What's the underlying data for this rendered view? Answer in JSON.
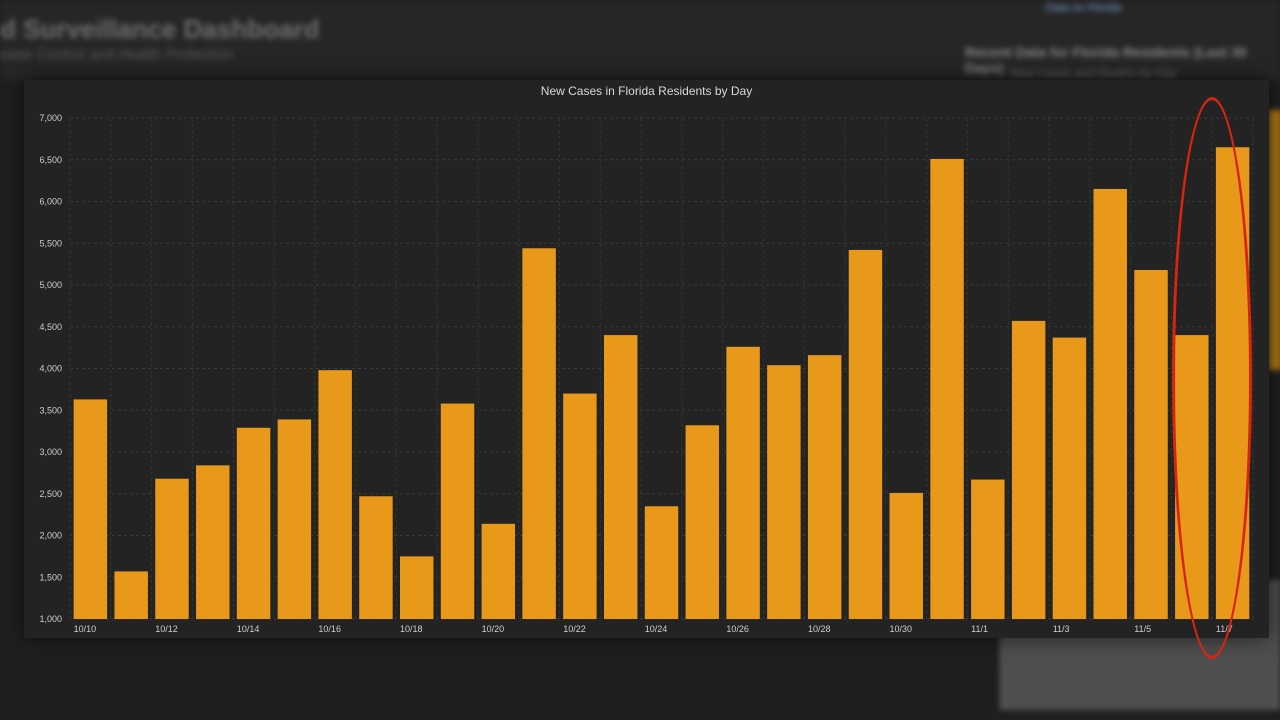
{
  "backdrop": {
    "title": "d Surveillance Dashboard",
    "subtitle": "ease Control and Health Protection",
    "right_title": "Recent Data for Florida Residents (Last 30 Days)",
    "right_subtitle": "New Cases and Deaths by Day",
    "link": "Data on Florida"
  },
  "chart_data": {
    "type": "bar",
    "title": "New Cases in Florida Residents by Day",
    "xlabel": "",
    "ylabel": "",
    "categories": [
      "10/10",
      "10/11",
      "10/12",
      "10/13",
      "10/14",
      "10/15",
      "10/16",
      "10/17",
      "10/18",
      "10/19",
      "10/20",
      "10/21",
      "10/22",
      "10/23",
      "10/24",
      "10/25",
      "10/26",
      "10/27",
      "10/28",
      "10/29",
      "10/30",
      "10/31",
      "11/1",
      "11/2",
      "11/3",
      "11/4",
      "11/5",
      "11/6",
      "11/7"
    ],
    "tick_labels": [
      "10/10",
      "10/12",
      "10/14",
      "10/16",
      "10/18",
      "10/20",
      "10/22",
      "10/24",
      "10/26",
      "10/28",
      "10/30",
      "11/1",
      "11/3",
      "11/5",
      "11/7"
    ],
    "values": [
      3630,
      1570,
      2680,
      2840,
      3290,
      3390,
      3980,
      2470,
      1750,
      3580,
      2140,
      5440,
      3700,
      4400,
      2350,
      3320,
      4260,
      4040,
      4160,
      5420,
      2510,
      6510,
      2670,
      4570,
      4370,
      6150,
      5180,
      4400,
      6650
    ],
    "ylim": [
      1000,
      7000
    ],
    "yticks": [
      "1,000",
      "1,500",
      "2,000",
      "2,500",
      "3,000",
      "3,500",
      "4,000",
      "4,500",
      "5,000",
      "5,500",
      "6,000",
      "6,500",
      "7,000"
    ],
    "grid": true,
    "bar_color": "#e8991a",
    "annotation_color": "#d8250f"
  }
}
